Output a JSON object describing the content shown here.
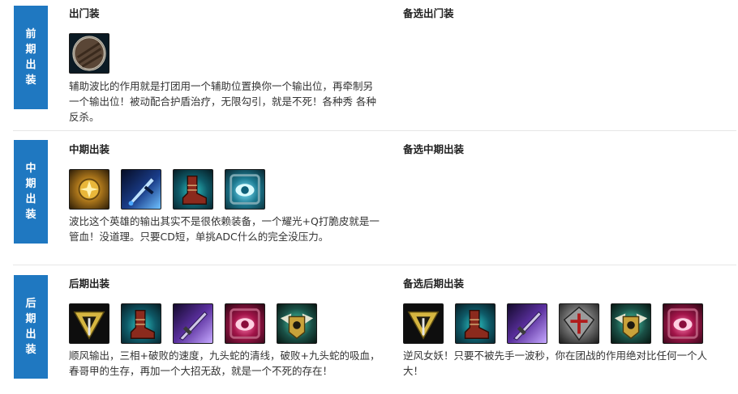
{
  "sections": [
    {
      "stage_label": "前期出装",
      "primary": {
        "title": "出门装",
        "items": [
          "wooden-shield-icon"
        ],
        "description": "辅助波比的作用就是打团用一个辅助位置换你一个输出位，再牵制另一个输出位！被动配合护盾治疗，无限勾引，就是不死！各种秀 各种反杀。"
      },
      "alternate": {
        "title": "备选出门装",
        "items": [],
        "description": ""
      }
    },
    {
      "stage_label": "中期出装",
      "primary": {
        "title": "中期出装",
        "items": [
          "golden-orb-icon",
          "blue-sword-icon",
          "red-boots-icon",
          "eye-relic-icon"
        ],
        "description": "波比这个英雄的输出其实不是很依赖装备，一个耀光+Q打脆皮就是一管血！没道理。只要CD短，单挑ADC什么的完全没压力。"
      },
      "alternate": {
        "title": "备选中期出装",
        "items": [],
        "description": ""
      }
    },
    {
      "stage_label": "后期出装",
      "primary": {
        "title": "后期出装",
        "items": [
          "triforce-icon",
          "red-boots-icon",
          "purple-blade-icon",
          "red-eye-icon",
          "aegis-helm-icon"
        ],
        "description": "顺风输出，三相+破败的速度，九头蛇的清线，破败+九头蛇的吸血，春哥甲的生存，再加一个大招无敌，就是一个不死的存在！"
      },
      "alternate": {
        "title": "备选后期出装",
        "items": [
          "triforce-icon",
          "red-boots-icon",
          "purple-blade-icon",
          "armor-cross-icon",
          "aegis-helm-icon",
          "red-eye-icon"
        ],
        "description": "逆风女妖！只要不被先手一波秒，你在团战的作用绝对比任何一个人大！"
      }
    }
  ]
}
